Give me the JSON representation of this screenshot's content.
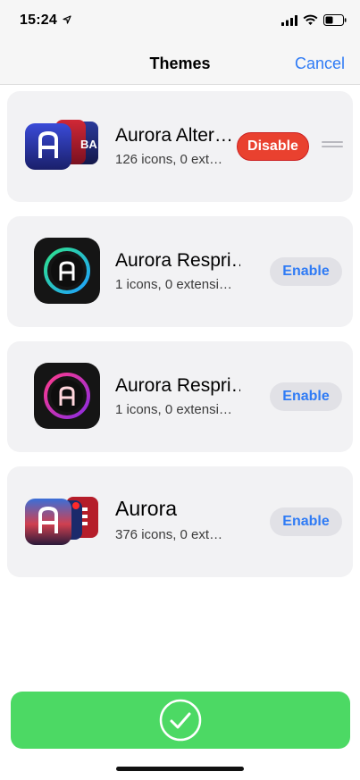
{
  "status_bar": {
    "time": "15:24"
  },
  "nav": {
    "title": "Themes",
    "cancel_label": "Cancel"
  },
  "themes": [
    {
      "title": "Aurora Alter…",
      "subtitle": "126 icons, 0 ext…",
      "action": "Disable",
      "enabled": true,
      "icon_badge_text": "BA"
    },
    {
      "title": "Aurora Respri…",
      "subtitle": "1 icons, 0 extensi…",
      "action": "Enable",
      "enabled": false
    },
    {
      "title": "Aurora Respri…",
      "subtitle": "1 icons, 0 extensi…",
      "action": "Enable",
      "enabled": false
    },
    {
      "title": "Aurora",
      "subtitle": "376 icons, 0 ext…",
      "action": "Enable",
      "enabled": false
    }
  ],
  "colors": {
    "accent": "#2f7bf5",
    "disable": "#e9412f",
    "confirm": "#4cd964",
    "card_bg": "#f2f2f4"
  },
  "icons": {
    "location": "location-arrow-icon",
    "signal": "cellular-signal-icon",
    "wifi": "wifi-icon",
    "battery": "battery-icon",
    "drag": "drag-handle-icon",
    "confirm": "checkmark-circle-icon"
  }
}
